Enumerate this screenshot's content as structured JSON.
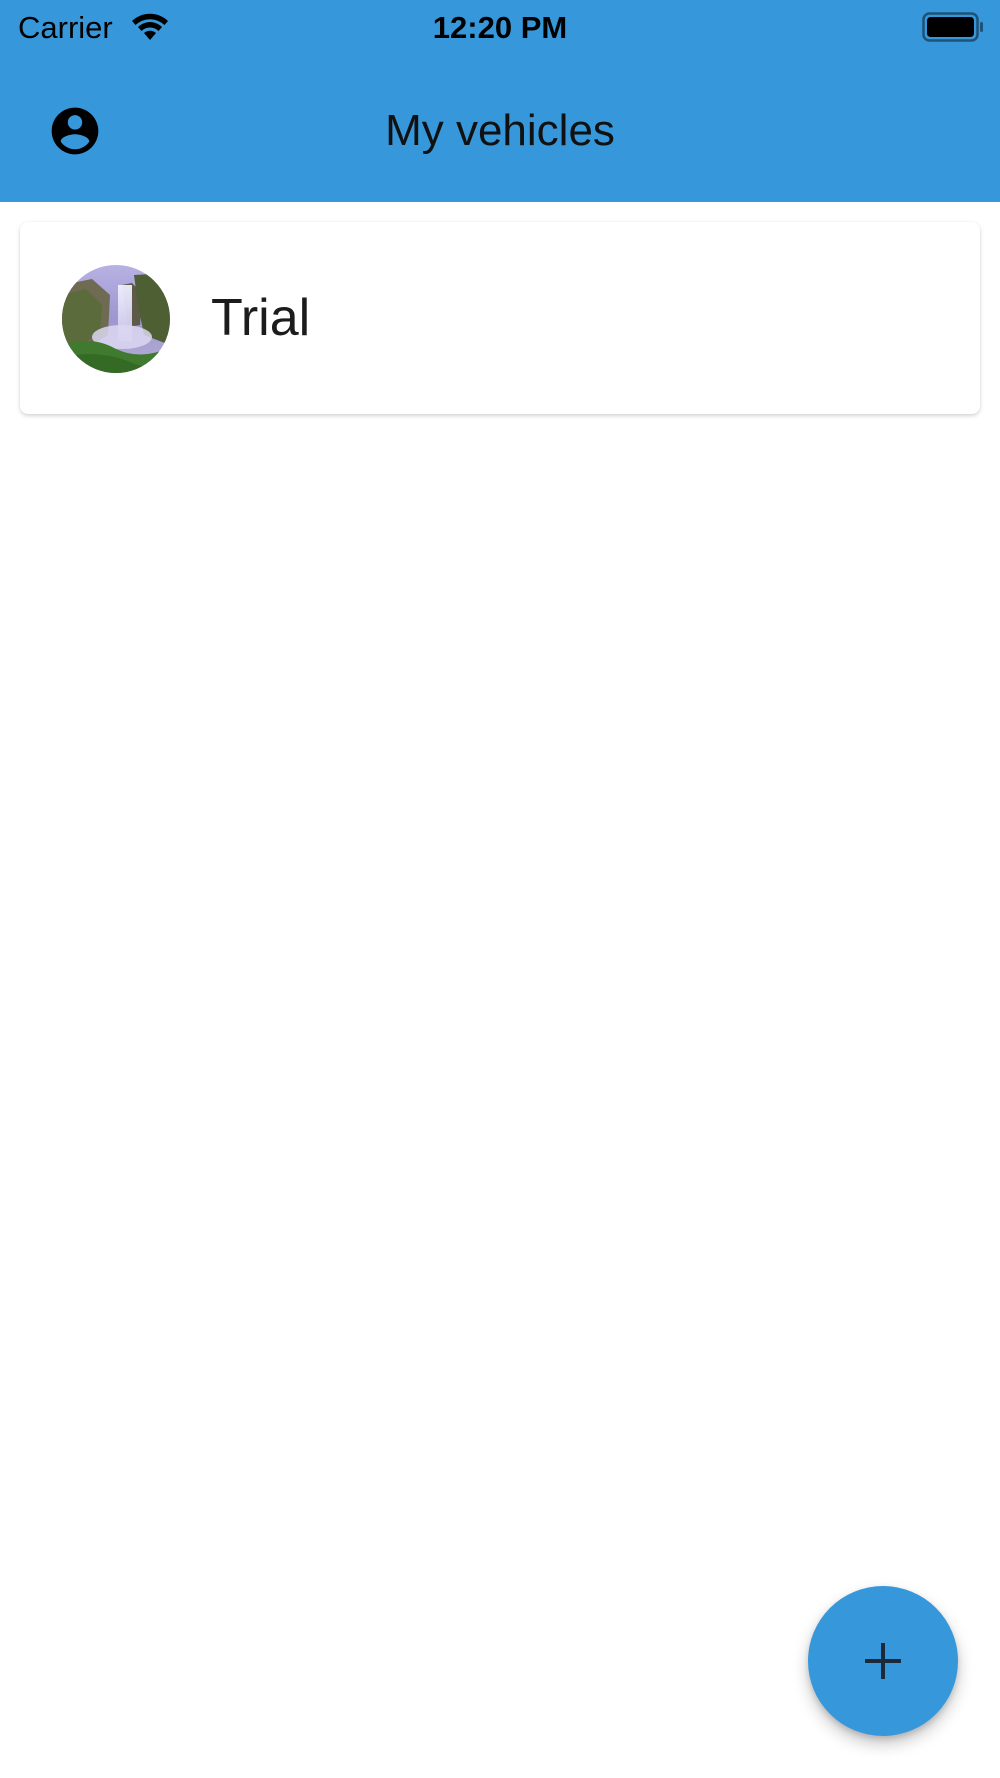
{
  "status_bar": {
    "carrier": "Carrier",
    "time": "12:20 PM",
    "wifi_icon": "wifi-icon",
    "battery_icon": "battery-full-icon"
  },
  "app_bar": {
    "title": "My vehicles",
    "account_icon": "account-circle-icon",
    "background_color": "#3797db"
  },
  "vehicles": [
    {
      "name": "Trial",
      "avatar": "waterfall-photo"
    }
  ],
  "fab": {
    "icon": "plus-icon",
    "color": "#3797db"
  }
}
